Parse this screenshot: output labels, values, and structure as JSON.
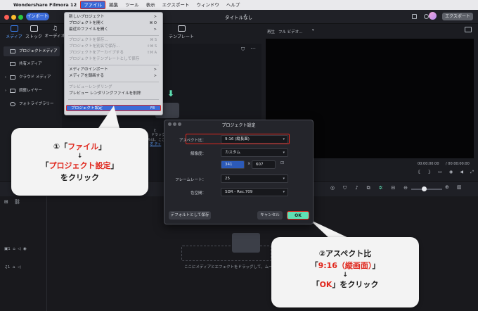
{
  "menubar": {
    "apple": "",
    "app_name": "Wondershare Filmora 12",
    "items": [
      "ファイル",
      "編集",
      "ツール",
      "表示",
      "エクスポート",
      "ウィンドウ",
      "ヘルプ"
    ]
  },
  "titlebar": {
    "import_label": "インポート",
    "title": "タイトルなし",
    "export_label": "エクスポート"
  },
  "toolbar": {
    "tabs": [
      "メディア",
      "ストック",
      "オーディオ"
    ],
    "template_label": "テンプレート"
  },
  "sidebar": {
    "items": [
      "プロジェクトメディア",
      "共有メディア",
      "クラウド メディア",
      "調整レイヤー",
      "フォトライブラリー"
    ]
  },
  "player": {
    "quality_label": "再生",
    "quality_value": "フル ビデオ...",
    "time_current": "00:00:00:00",
    "time_total": "/ 00:00:00:00"
  },
  "media_hint": {
    "fragments": [
      "と",
      "ドラッグ",
      "ルは、ここ",
      "オ ティ"
    ]
  },
  "timeline": {
    "drop_hint": "ここにメディアとエフェクトをドラッグして、ムー"
  },
  "file_menu": {
    "items": [
      {
        "label": "新しいプロジェクト",
        "shortcut": ">",
        "disabled": false
      },
      {
        "label": "プロジェクトを開く",
        "shortcut": "⌘ O",
        "disabled": false
      },
      {
        "label": "最近のファイルを開く",
        "shortcut": ">",
        "disabled": false
      },
      {
        "label": "プロジェクトを保存...",
        "shortcut": "⌘ S",
        "disabled": true
      },
      {
        "label": "プロジェクトを別名で保存...",
        "shortcut": "⇧⌘ S",
        "disabled": true
      },
      {
        "label": "プロジェクトをアーカイブする",
        "shortcut": "⇧⌘ A",
        "disabled": true
      },
      {
        "label": "プロジェクトをテンプレートとして保存",
        "shortcut": "",
        "disabled": true
      },
      {
        "label": "メディアのインポート",
        "shortcut": ">",
        "disabled": false
      },
      {
        "label": "メディアを録画する",
        "shortcut": ">",
        "disabled": false
      },
      {
        "label": "プレビューレンダリング",
        "shortcut": "",
        "disabled": true
      },
      {
        "label": "プレビュー レンダリングファイルを削除",
        "shortcut": "",
        "disabled": false
      },
      {
        "label": "プロジェクト設定",
        "shortcut": "F8",
        "disabled": false
      }
    ]
  },
  "dialog": {
    "title": "プロジェクト設定",
    "aspect_label": "アスペクト比：",
    "aspect_value": "9:16 (縦長面)",
    "resolution_label": "解像度：",
    "resolution_value": "カスタム",
    "width_value": "341",
    "times": "×",
    "height_value": "607",
    "framerate_label": "フレームレート：",
    "framerate_value": "25",
    "colorspace_label": "色空間：",
    "colorspace_value": "SDR - Rec.709",
    "default_button": "デフォルトとして保存",
    "cancel_button": "キャンセル",
    "ok_button": "OK"
  },
  "callout1": {
    "line1_prefix": "①「",
    "line1_red": "ファイル",
    "line1_suffix": "」",
    "arrow": "↓",
    "line2_prefix": "「",
    "line2_red": "プロジェクト設定",
    "line2_suffix": "」",
    "line3": "をクリック"
  },
  "callout2": {
    "line1": "②アスペクト比",
    "line2_prefix": "「",
    "line2_red": "9:16（縦画面）",
    "line2_suffix": "」",
    "arrow": "↓",
    "line3_prefix": "「",
    "line3_red": "OK",
    "line3_suffix": "」をクリック"
  },
  "colors": {
    "accent_blue": "#3b6bd8",
    "highlight_red": "#e0271d",
    "ok_green": "#5fe0b4",
    "export_gray": "#5d6068"
  }
}
